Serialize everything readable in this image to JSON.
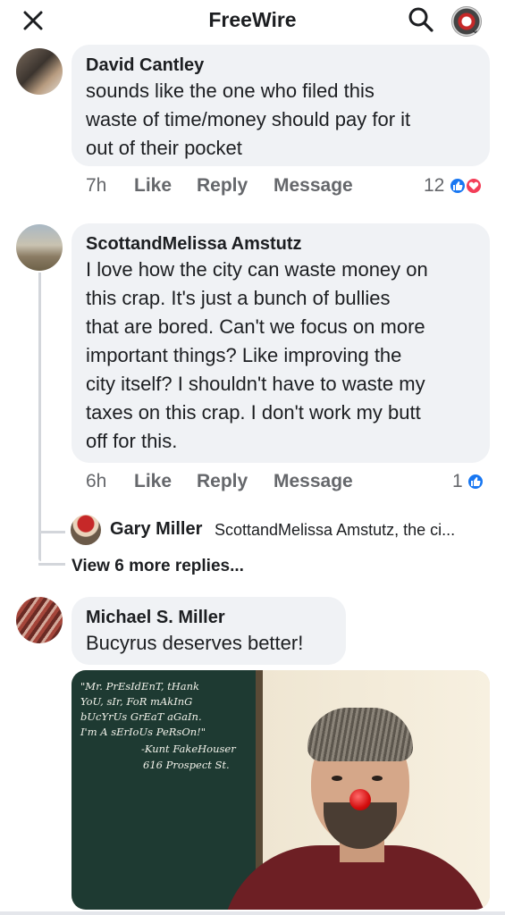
{
  "header": {
    "title": "FreeWire",
    "close_icon": "close-icon",
    "search_icon": "search-icon",
    "profile_icon": "profile-avatar-icon"
  },
  "comments": [
    {
      "author": "David Cantley",
      "lines": [
        "sounds like the one who filed this",
        "waste of time/money should pay for it",
        "out of their pocket"
      ],
      "time": "7h",
      "like": "Like",
      "reply": "Reply",
      "message": "Message",
      "reactions": "12"
    },
    {
      "author": "ScottandMelissa Amstutz",
      "lines": [
        "I love how the city can waste money on",
        "this crap. It's just a bunch of bullies",
        "that are bored. Can't we focus on more",
        "important things? Like improving the",
        "city itself? I shouldn't have to waste my",
        "taxes on this crap. I don't work my butt",
        "off for this."
      ],
      "time": "6h",
      "like": "Like",
      "reply": "Reply",
      "message": "Message",
      "reactions": "1"
    },
    {
      "author": "Michael S. Miller",
      "lines": [
        "Bucyrus deserves better!"
      ]
    }
  ],
  "reply_preview": {
    "author": "Gary Miller",
    "text": "ScottandMelissa Amstutz, the ci..."
  },
  "view_more": "View 6 more replies...",
  "meme": {
    "lines": [
      "\"Mr. PrEsIdEnT, tHank",
      "YoU, sIr, FoR mAkInG",
      "bUcYrUs GrEaT aGaIn.",
      "I'm A sErIoUs PeRsOn!\"",
      "-Kunt FakeHouser",
      "616 Prospect St."
    ]
  },
  "colors": {
    "like_blue": "#1877f2",
    "love_red": "#f33e58",
    "bubble_gray": "#f0f2f5",
    "meta_gray": "#65676b"
  }
}
